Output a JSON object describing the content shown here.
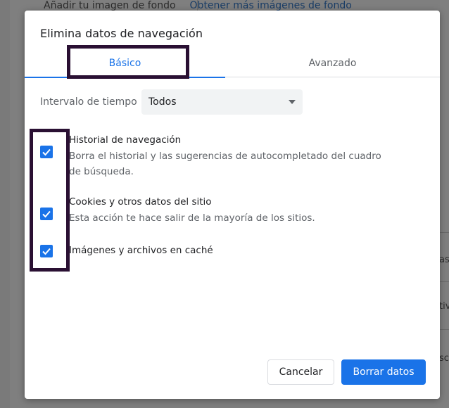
{
  "background": {
    "top_label": "Añadir tu imagen de fondo",
    "top_link": "Obtener más imágenes de fondo",
    "side_fragments": [
      "as",
      "tiv",
      "sc"
    ]
  },
  "dialog": {
    "title": "Elimina datos de navegación",
    "tabs": [
      {
        "label": "Básico",
        "active": true
      },
      {
        "label": "Avanzado",
        "active": false
      }
    ],
    "time_range": {
      "label": "Intervalo de tiempo",
      "selected": "Todos"
    },
    "options": [
      {
        "title": "Historial de navegación",
        "description": "Borra el historial y las sugerencias de autocompletado del cuadro de búsqueda.",
        "checked": true
      },
      {
        "title": "Cookies y otros datos del sitio",
        "description": "Esta acción te hace salir de la mayoría de los sitios.",
        "checked": true
      },
      {
        "title": "Imágenes y archivos en caché",
        "description": "",
        "checked": true
      }
    ],
    "buttons": {
      "cancel": "Cancelar",
      "clear": "Borrar datos"
    }
  },
  "colors": {
    "accent": "#1a73e8",
    "highlight_box": "#2a1033",
    "overlay": "#7f7f7f"
  }
}
